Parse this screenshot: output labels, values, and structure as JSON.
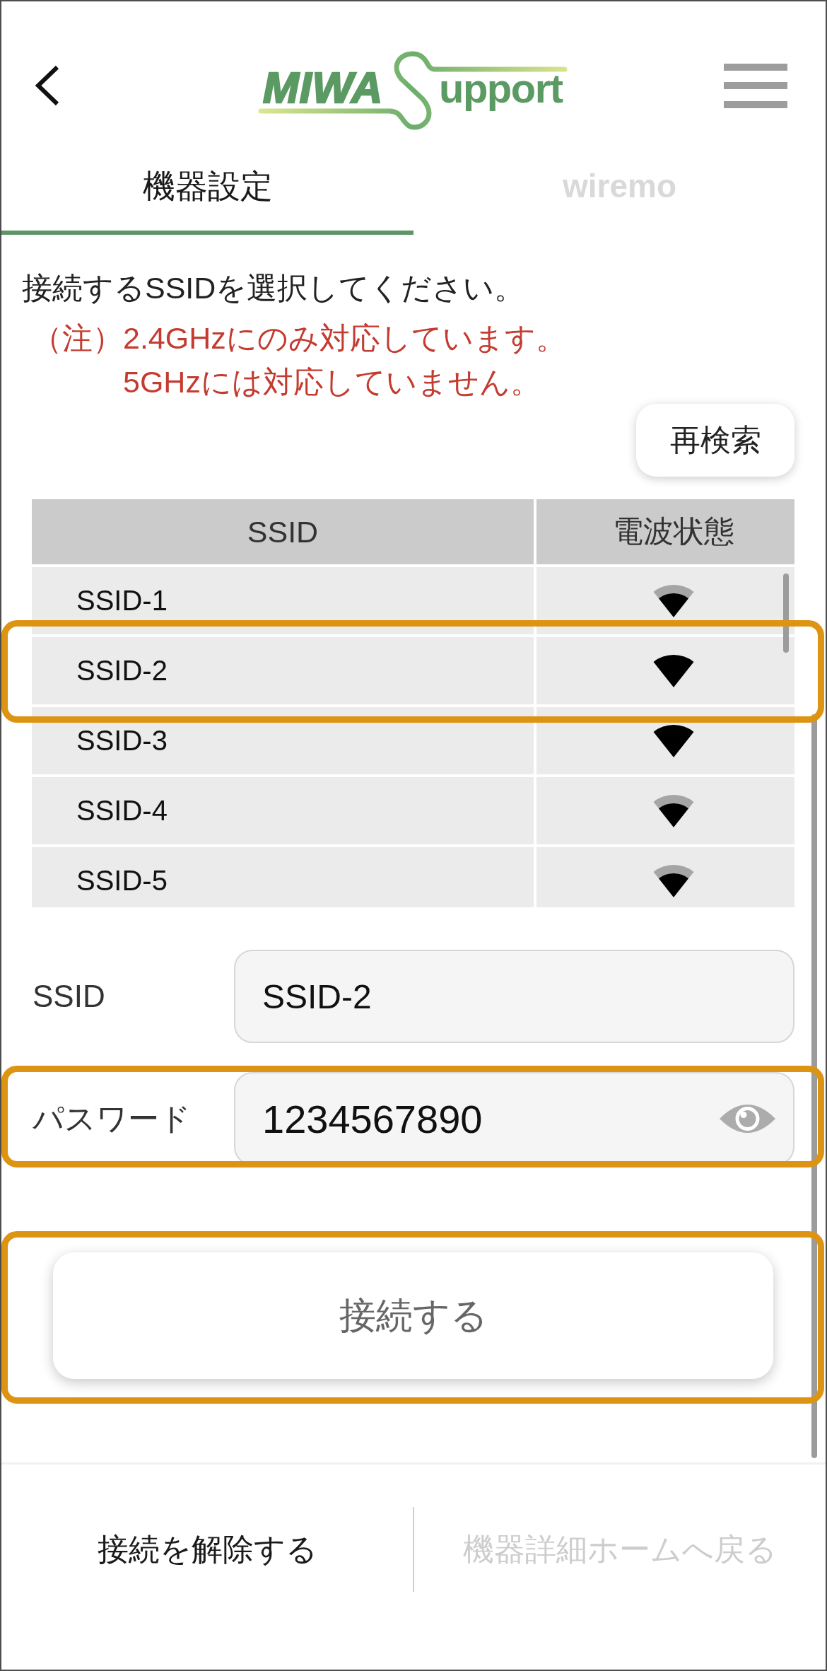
{
  "logo": {
    "mark": "MIWA",
    "word": "upport"
  },
  "tabs": [
    {
      "label": "機器設定",
      "selected": true
    },
    {
      "label": "wiremo",
      "selected": false
    }
  ],
  "instruction": "接続するSSIDを選択してください。",
  "note": {
    "label": "（注）",
    "lines": [
      "2.4GHzにのみ対応しています。",
      "5GHzには対応していません。"
    ]
  },
  "rescan_button": {
    "label": "再検索"
  },
  "ssid_table": {
    "columns": [
      "SSID",
      "電波状態"
    ],
    "rows": [
      {
        "ssid": "SSID-1",
        "kind": "medium",
        "highlighted": false
      },
      {
        "ssid": "SSID-2",
        "kind": "strong",
        "highlighted": true
      },
      {
        "ssid": "SSID-3",
        "kind": "strong",
        "highlighted": false
      },
      {
        "ssid": "SSID-4",
        "kind": "medium",
        "highlighted": false
      },
      {
        "ssid": "SSID-5",
        "kind": "medium",
        "highlighted": false
      }
    ]
  },
  "form": {
    "fields": [
      {
        "kind": "text",
        "label": "SSID",
        "value": "SSID-2",
        "highlighted": false
      },
      {
        "kind": "password",
        "label": "パスワード",
        "value": "1234567890",
        "highlighted": true
      }
    ]
  },
  "connect_button": {
    "label": "接続する",
    "highlighted": true
  },
  "footer": {
    "actions": [
      {
        "label": "接続を解除する",
        "disabled": false
      },
      {
        "label": "機器詳細ホームへ戻る",
        "disabled": true
      }
    ]
  }
}
